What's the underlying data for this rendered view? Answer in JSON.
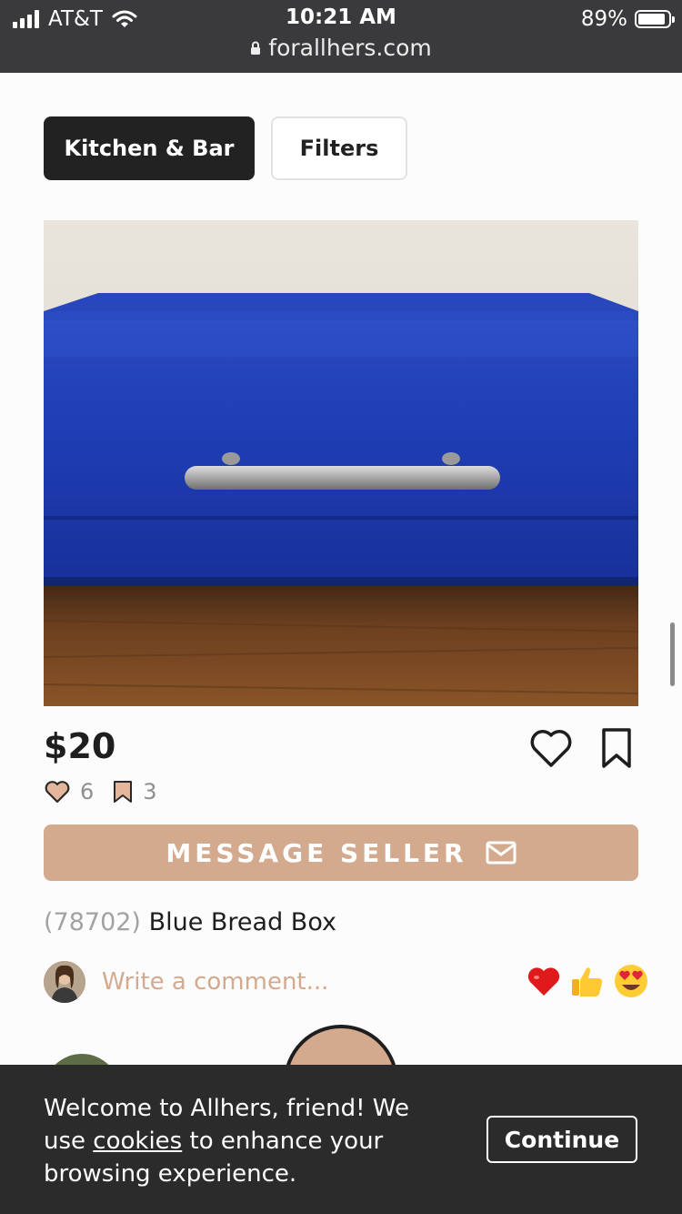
{
  "status_bar": {
    "carrier": "AT&T",
    "time": "10:21 AM",
    "battery": "89%"
  },
  "browser": {
    "url": "forallhers.com"
  },
  "filters": {
    "category_label": "Kitchen & Bar",
    "filters_label": "Filters"
  },
  "listing": {
    "price": "$20",
    "likes": "6",
    "saves": "3",
    "message_button": "MESSAGE SELLER",
    "zip": "(78702)",
    "title": "Blue Bread Box"
  },
  "comments": {
    "placeholder": "Write a comment...",
    "reactions": [
      "heart",
      "thumbs-up",
      "heart-eyes"
    ]
  },
  "cookie_banner": {
    "text_before": "Welcome to Allhers, friend! We use",
    "link": "cookies",
    "text_after": "to enhance your browsing experience.",
    "button": "Continue"
  },
  "colors": {
    "accent": "#d4aa8f",
    "dark": "#222222",
    "product_blue": "#1e3fb0"
  }
}
